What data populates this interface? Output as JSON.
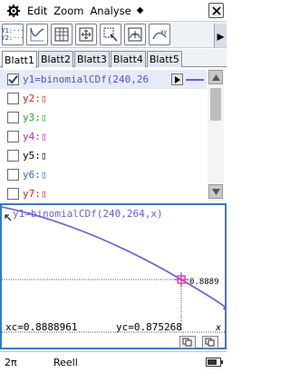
{
  "menu": {
    "items": [
      "Edit",
      "Zoom",
      "Analyse"
    ],
    "more": "◆",
    "close": "×"
  },
  "toolbar": {
    "y12": [
      "Y1:···",
      "Y2:···"
    ],
    "buttons": [
      "y-list-icon",
      "graph-type-icon",
      "table-icon",
      "zoom-box-icon",
      "zoom-select-icon",
      "zoom-fit-icon",
      "trace-icon"
    ],
    "more_arrow": "▸"
  },
  "tabs": [
    "Blatt1",
    "Blatt2",
    "Blatt3",
    "Blatt4",
    "Blatt5"
  ],
  "functions": [
    {
      "label": "y1=binomialCDf(240,26",
      "checked": true,
      "color": "#5a4fd6"
    },
    {
      "label": "y2:▯",
      "checked": false,
      "color": "#d6241c"
    },
    {
      "label": "y3:▯",
      "checked": false,
      "color": "#18a81e"
    },
    {
      "label": "y4:▯",
      "checked": false,
      "color": "#c21fc6"
    },
    {
      "label": "y5:▯",
      "checked": false,
      "color": "#000000"
    },
    {
      "label": "y6:▯",
      "checked": false,
      "color": "#2a63d4"
    },
    {
      "label": "y7:▯",
      "checked": false,
      "color": "#d6241c"
    }
  ],
  "graph": {
    "expression": "y1=binomialCDf(240,264,x)",
    "xc_label": "xc=0.8888961",
    "yc_label": "yc=0.875268",
    "x_axis": "x",
    "tick_y": "0.8889",
    "curve_color": "#6a5de0",
    "frame_color": "#3a78c2"
  },
  "status": {
    "angle": "2π",
    "mode": "Reell"
  },
  "battery_level": 0.75
}
